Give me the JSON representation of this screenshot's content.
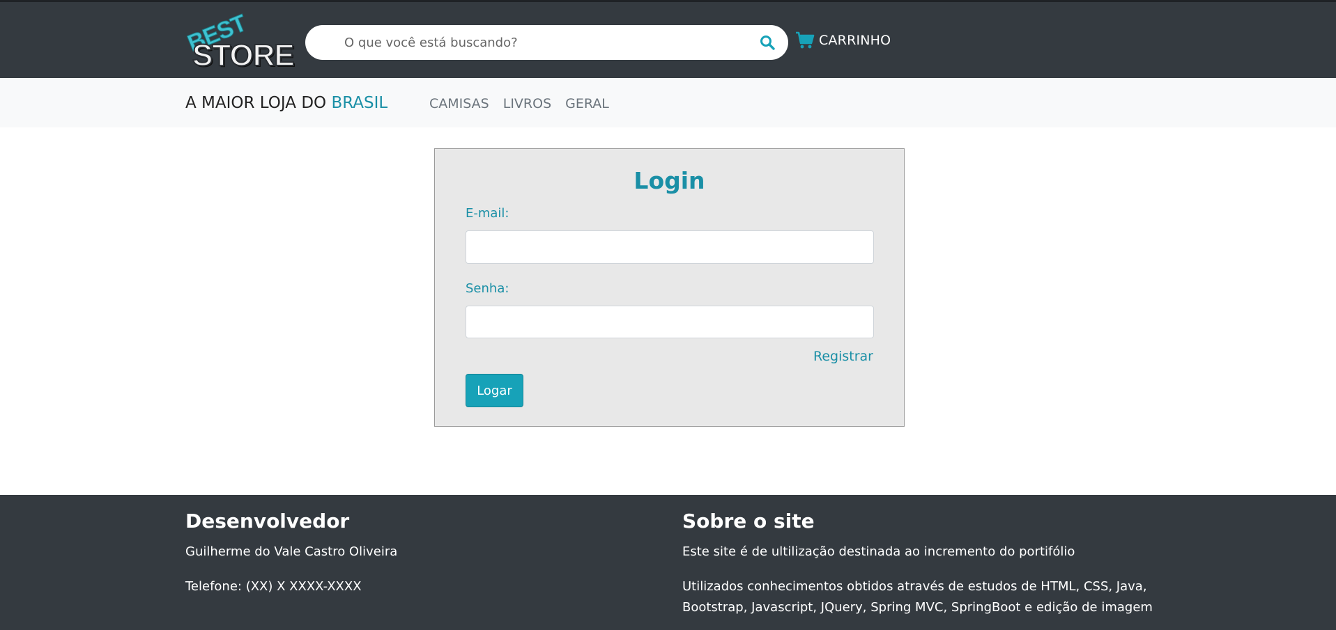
{
  "header": {
    "logo_top": "BEST",
    "logo_bottom": "STORE",
    "search_placeholder": "O que você está buscando?",
    "search_icon": "search-icon",
    "cart_icon": "cart-icon",
    "cart_label": "CARRINHO",
    "accent_color": "#17a2b8"
  },
  "subnav": {
    "tagline_prefix": "A MAIOR LOJA DO ",
    "tagline_accent": "BRASIL",
    "links": [
      "CAMISAS",
      "LIVROS",
      "GERAL"
    ]
  },
  "login": {
    "title": "Login",
    "email_label": "E-mail:",
    "email_value": "",
    "password_label": "Senha:",
    "password_value": "",
    "register_link": "Registrar",
    "submit_label": "Logar"
  },
  "footer": {
    "developer": {
      "heading": "Desenvolvedor",
      "name": "Guilherme do Vale Castro Oliveira",
      "phone": "Telefone: (XX) X XXXX-XXXX"
    },
    "about": {
      "heading": "Sobre o site",
      "line1": "Este site é de ultilização destinada ao incremento do portifólio",
      "line2": "Utilizados conhecimentos obtidos através de estudos de HTML, CSS, Java,",
      "line3": "Bootstrap, Javascript, JQuery, Spring MVC, SpringBoot e edição de imagem"
    }
  }
}
